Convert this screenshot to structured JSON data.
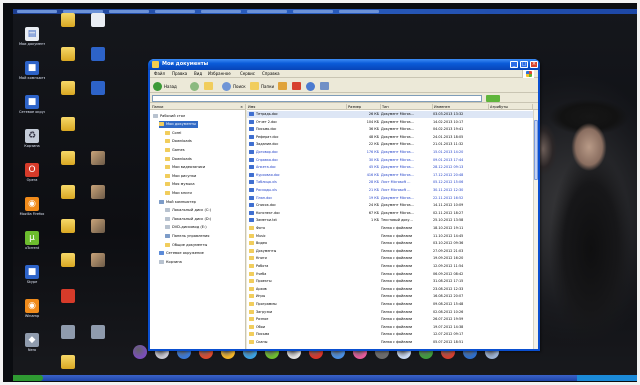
{
  "window": {
    "title": "Мои документы",
    "menu": [
      "Файл",
      "Правка",
      "Вид",
      "Избранное",
      "Сервис",
      "Справка"
    ],
    "toolbar": {
      "back": "Назад",
      "search": "Поиск",
      "folders": "Папки"
    },
    "tree_header": "Папки",
    "tree_items": [
      {
        "label": "Рабочий стол",
        "indent": 0,
        "icon": "desktop"
      },
      {
        "label": "Мои документы",
        "indent": 1,
        "icon": "folder",
        "selected": true
      },
      {
        "label": "Corel",
        "indent": 2,
        "icon": "folder"
      },
      {
        "label": "Downloads",
        "indent": 2,
        "icon": "folder"
      },
      {
        "label": "Games",
        "indent": 2,
        "icon": "folder"
      },
      {
        "label": "Downloads",
        "indent": 2,
        "icon": "folder"
      },
      {
        "label": "Мои видеозаписи",
        "indent": 2,
        "icon": "folder"
      },
      {
        "label": "Мои рисунки",
        "indent": 2,
        "icon": "folder"
      },
      {
        "label": "Моя музыка",
        "indent": 2,
        "icon": "folder"
      },
      {
        "label": "Мои книги",
        "indent": 2,
        "icon": "folder"
      },
      {
        "label": "Мой компьютер",
        "indent": 1,
        "icon": "computer"
      },
      {
        "label": "Локальный диск (C:)",
        "indent": 2,
        "icon": "drive"
      },
      {
        "label": "Локальный диск (D:)",
        "indent": 2,
        "icon": "drive"
      },
      {
        "label": "DVD-дисковод (E:)",
        "indent": 2,
        "icon": "drive"
      },
      {
        "label": "Панель управления",
        "indent": 2,
        "icon": "computer"
      },
      {
        "label": "Общие документы",
        "indent": 2,
        "icon": "folder"
      },
      {
        "label": "Сетевое окружение",
        "indent": 1,
        "icon": "network"
      },
      {
        "label": "Корзина",
        "indent": 1,
        "icon": "drive"
      }
    ],
    "columns": [
      "Имя",
      "Размер",
      "Тип",
      "Изменен",
      "Атрибуты"
    ],
    "files": [
      {
        "name": "Тетрадь.doc",
        "size": "26 КБ",
        "type": "Документ Micros...",
        "date": "03.03.2013 13:32",
        "style": "doc"
      },
      {
        "name": "Отчет 2.doc",
        "size": "104 КБ",
        "type": "Документ Micros...",
        "date": "14.02.2013 10:17",
        "style": "doc"
      },
      {
        "name": "Письмо.doc",
        "size": "36 КБ",
        "type": "Документ Micros...",
        "date": "04.02.2013 19:41",
        "style": "doc"
      },
      {
        "name": "Реферат.doc",
        "size": "48 КБ",
        "type": "Документ Micros...",
        "date": "24.01.2013 18:05",
        "style": "doc"
      },
      {
        "name": "Задание.doc",
        "size": "22 КБ",
        "type": "Документ Micros...",
        "date": "21.01.2013 11:32",
        "style": "doc"
      },
      {
        "name": "Договор.doc",
        "size": "176 КБ",
        "type": "Документ Micros...",
        "date": "15.01.2013 14:20",
        "style": "comp"
      },
      {
        "name": "Справка.doc",
        "size": "30 КБ",
        "type": "Документ Micros...",
        "date": "09.01.2013 17:44",
        "style": "comp"
      },
      {
        "name": "Анкета.doc",
        "size": "45 КБ",
        "type": "Документ Micros...",
        "date": "28.12.2012 09:13",
        "style": "comp"
      },
      {
        "name": "Курсовая.doc",
        "size": "416 КБ",
        "type": "Документ Micros...",
        "date": "17.12.2012 20:48",
        "style": "comp"
      },
      {
        "name": "Таблица.xls",
        "size": "28 КБ",
        "type": "Лист Microsoft ...",
        "date": "05.12.2012 15:06",
        "style": "comp"
      },
      {
        "name": "Расходы.xls",
        "size": "21 КБ",
        "type": "Лист Microsoft ...",
        "date": "30.11.2012 12:30",
        "style": "comp"
      },
      {
        "name": "План.doc",
        "size": "19 КБ",
        "type": "Документ Micros...",
        "date": "22.11.2012 16:52",
        "style": "comp"
      },
      {
        "name": "Список.doc",
        "size": "24 КБ",
        "type": "Документ Micros...",
        "date": "14.11.2012 10:09",
        "style": "doc"
      },
      {
        "name": "Конспект.doc",
        "size": "67 КБ",
        "type": "Документ Micros...",
        "date": "02.11.2012 18:27",
        "style": "doc"
      },
      {
        "name": "Заметки.txt",
        "size": "1 КБ",
        "type": "Текстовый доку...",
        "date": "25.10.2012 13:58",
        "style": "doc"
      },
      {
        "name": "Фото",
        "size": "",
        "type": "Папка с файлами",
        "date": "18.10.2012 19:11",
        "style": "folder"
      },
      {
        "name": "Music",
        "size": "",
        "type": "Папка с файлами",
        "date": "11.10.2012 14:45",
        "style": "folder"
      },
      {
        "name": "Видео",
        "size": "",
        "type": "Папка с файлами",
        "date": "03.10.2012 09:36",
        "style": "folder"
      },
      {
        "name": "Документы",
        "size": "",
        "type": "Папка с файлами",
        "date": "27.09.2012 21:03",
        "style": "folder"
      },
      {
        "name": "Книги",
        "size": "",
        "type": "Папка с файлами",
        "date": "19.09.2012 16:20",
        "style": "folder"
      },
      {
        "name": "Работа",
        "size": "",
        "type": "Папка с файлами",
        "date": "12.09.2012 11:54",
        "style": "folder"
      },
      {
        "name": "Учеба",
        "size": "",
        "type": "Папка с файлами",
        "date": "06.09.2012 08:42",
        "style": "folder"
      },
      {
        "name": "Проекты",
        "size": "",
        "type": "Папка с файлами",
        "date": "31.08.2012 17:15",
        "style": "folder"
      },
      {
        "name": "Архив",
        "size": "",
        "type": "Папка с файлами",
        "date": "23.08.2012 12:33",
        "style": "folder"
      },
      {
        "name": "Игры",
        "size": "",
        "type": "Папка с файлами",
        "date": "16.08.2012 20:07",
        "style": "folder"
      },
      {
        "name": "Программы",
        "size": "",
        "type": "Папка с файлами",
        "date": "09.08.2012 15:48",
        "style": "folder"
      },
      {
        "name": "Загрузки",
        "size": "",
        "type": "Папка с файлами",
        "date": "02.08.2012 10:26",
        "style": "folder"
      },
      {
        "name": "Разное",
        "size": "",
        "type": "Папка с файлами",
        "date": "26.07.2012 19:59",
        "style": "folder"
      },
      {
        "name": "Обои",
        "size": "",
        "type": "Папка с файлами",
        "date": "19.07.2012 14:38",
        "style": "folder"
      },
      {
        "name": "Письма",
        "size": "",
        "type": "Папка с файлами",
        "date": "12.07.2012 09:17",
        "style": "folder"
      },
      {
        "name": "Сканы",
        "size": "",
        "type": "Папка с файлами",
        "date": "05.07.2012 18:51",
        "style": "folder"
      }
    ]
  },
  "desktop_icons": [
    {
      "label": "Мои документы",
      "style": "doc"
    },
    {
      "label": "Мой компьютер",
      "style": "blue"
    },
    {
      "label": "Сетевое окружение",
      "style": "blue"
    },
    {
      "label": "Корзина",
      "style": "trash"
    },
    {
      "label": "Opera",
      "style": "red"
    },
    {
      "label": "Mozilla Firefox",
      "style": "orange"
    },
    {
      "label": "uTorrent",
      "style": "green"
    },
    {
      "label": "Skype",
      "style": "blue"
    },
    {
      "label": "Winamp",
      "style": "orange"
    },
    {
      "label": "Nero",
      "style": "gray"
    }
  ],
  "colors": {
    "titlebar": "#0a5bd8",
    "selection": "#316ac5",
    "window_bg": "#ece9d8",
    "compressed_text": "#1f3fc7"
  }
}
